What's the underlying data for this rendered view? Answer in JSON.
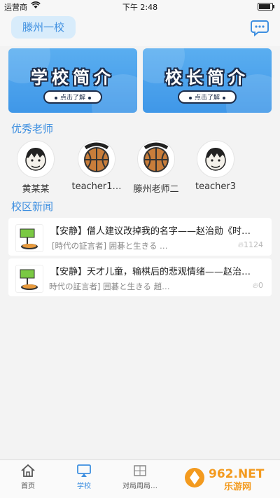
{
  "status_bar": {
    "carrier": "运营商",
    "time": "下午 2:48"
  },
  "header": {
    "school_name": "滕州一校"
  },
  "banners": [
    {
      "title": "学校简介",
      "button": "点击了解"
    },
    {
      "title": "校长简介",
      "button": "点击了解"
    }
  ],
  "sections": {
    "teachers_title": "优秀老师",
    "news_title": "校区新闻"
  },
  "teachers": [
    {
      "name": "黄某某",
      "avatar_icon": "cartoon-face-icon"
    },
    {
      "name": "teacher1…",
      "avatar_icon": "basketball-avatar-icon"
    },
    {
      "name": "滕州老师二",
      "avatar_icon": "basketball-avatar-icon"
    },
    {
      "name": "teacher3",
      "avatar_icon": "cartoon-face-icon"
    }
  ],
  "news": [
    {
      "title": "【安静】僧人建议改掉我的名字——赵治勋《时…",
      "subtitle": "[時代の証言者] 囲碁と生きる …",
      "views": "1124"
    },
    {
      "title": "【安静】天才儿童，输棋后的悲观情绪——赵治…",
      "subtitle": "時代の証言者] 囲碁と生きる 趙…",
      "views": "0"
    }
  ],
  "tabs": [
    {
      "label": "首页",
      "icon": "home-icon",
      "active": false
    },
    {
      "label": "学校",
      "icon": "monitor-icon",
      "active": true
    },
    {
      "label": "对局周局…",
      "icon": "game-icon",
      "active": false
    }
  ],
  "watermark": {
    "text": "962.NET",
    "subtext": "乐游网"
  },
  "colors": {
    "accent": "#3e8fe0",
    "banner": "#4aa3ee",
    "chip_bg": "#d8ecfb"
  }
}
